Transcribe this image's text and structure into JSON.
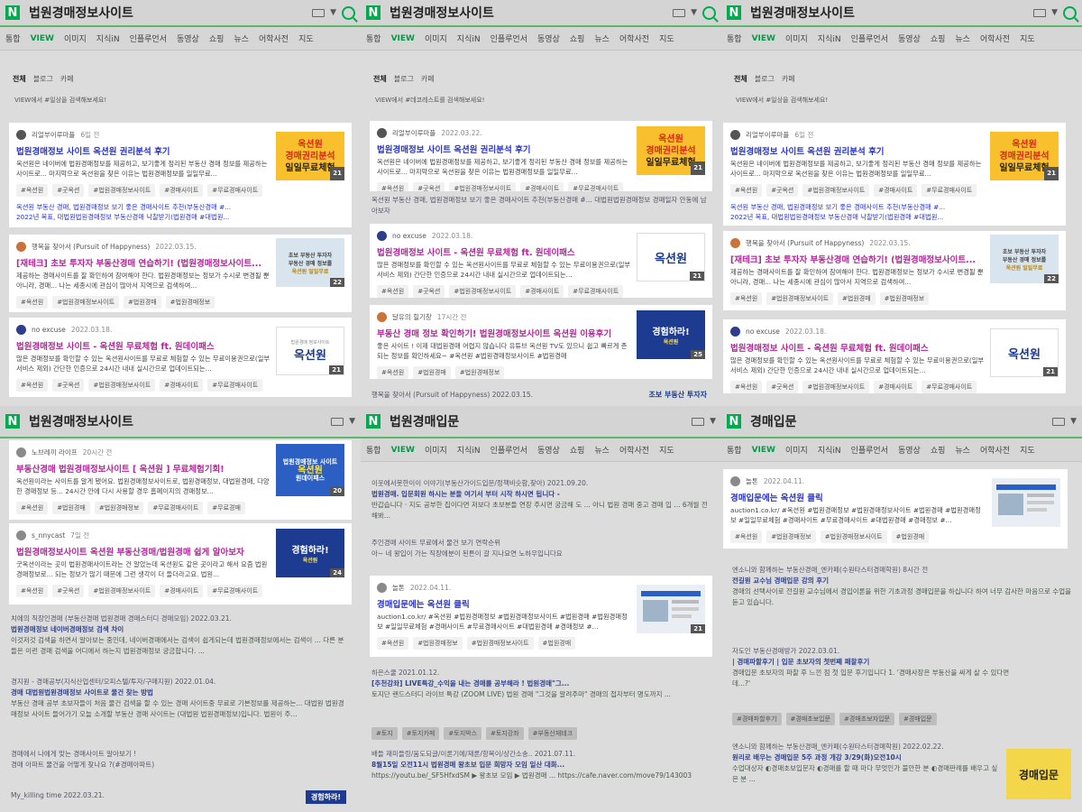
{
  "panels": [
    {
      "query": "법원경매정보사이트",
      "tabs": [
        "통합",
        "VIEW",
        "이미지",
        "지식iN",
        "인플루언서",
        "동영상",
        "쇼핑",
        "뉴스",
        "어학사전",
        "지도"
      ],
      "filter": {
        "all": "전체",
        "blog": "블로그",
        "cafe": "카페"
      },
      "notice": "VIEW에서 #일상을 검색해보세요!",
      "cards": [
        {
          "author": "리얼부이루마플",
          "date": "6일 전",
          "title": "법원경매정보 사이트 옥션원 권리분석 후기",
          "desc": "옥션원은 네이버에 법원경매정보를 제공하고, 보기좋게 정리된 부동산 경매 정보를 제공하는 사이트로... 마지막으로 옥션원을 찾은 이유는 법원경매정보를 일일무료...",
          "tags": [
            "#옥션원",
            "#굿옥션",
            "#법원경매정보사이트",
            "#경매사이트",
            "#무료경매사이트"
          ],
          "extra": [
            "옥션원 부동산 경매, 법원경매정보 보기 좋은 경매사이트 추천(부동산경매 #...",
            "2022년 목표, 대법원법원경매정보 부동산경매 낙찰받기(법원경매 #대법원..."
          ],
          "thumb": {
            "line1": "옥션원",
            "line2": "경매권리분석",
            "line3": "일일무료체험",
            "count": "21"
          }
        },
        {
          "author": "행복을 찾아서 (Pursuit of Happyness)",
          "date": "2022.03.15.",
          "title": "[재테크] 초보 투자자 부동산경매 연습하기! (법원경매정보사이트...",
          "desc": "제공하는 경매사이트를 잘 확인하여 참여해야 한다. 법원경매정보는 정보가 수시로 변경될 뿐 아니라, 경매... 나는 세종시에 관심이 많아서 지역으로 검색하여...",
          "tags": [
            "#옥션원",
            "#법원경매정보사이트",
            "#법원경매",
            "#법원경매정보"
          ],
          "thumb": {
            "line1": "초보 부동산 투자자",
            "line2": "부동산 경매 정보를",
            "line3": "옥션원 일일무료",
            "count": "22"
          }
        },
        {
          "author": "no excuse",
          "date": "2022.03.18.",
          "title": "법원경매정보 사이트 - 옥션원 무료체험 ft. 원데이패스",
          "desc": "많은 경매정보를 확인할 수 있는 옥션원사이트를 무료로 체험할 수 있는 무료이용권으로(일부서비스 제외) 간단한 인증으로 24시간 내내 실시간으로 업데이트되는...",
          "tags": [
            "#옥션원",
            "#굿옥션",
            "#법원경매정보사이트",
            "#경매사이트",
            "#무료경매사이트"
          ],
          "thumb": {
            "line1": "옥션원",
            "line2": "법원경매 정보사이트",
            "count": "21"
          }
        }
      ]
    },
    {
      "query": "법원경매정보사이트",
      "tabs": [
        "통합",
        "VIEW",
        "이미지",
        "지식iN",
        "인플루언서",
        "동영상",
        "쇼핑",
        "뉴스",
        "어학사전",
        "지도"
      ],
      "filter": {
        "all": "전체",
        "blog": "블로그",
        "cafe": "카페"
      },
      "notice": "VIEW에서 #데코레스트를 검색해보세요!",
      "cards": [
        {
          "author": "리얼부이루마플",
          "date": "2022.03.22.",
          "title": "법원경매정보 사이트 옥션원 권리분석 후기",
          "desc": "옥션원은 네이버에 법원경매정보를 제공하고, 보기좋게 정리된 부동산 경매 정보를 제공하는 사이트로... 마지막으로 옥션원을 찾은 이유는 법원경매정보를 일일무료...",
          "tags": [
            "#옥션원",
            "#굿옥션",
            "#법원경매정보사이트",
            "#경매사이트",
            "#무료경매사이트"
          ],
          "thumb": {
            "line1": "옥션원",
            "line2": "경매권리분석",
            "line3": "일일무료체험",
            "count": "21"
          }
        },
        {
          "author": "no excuse",
          "date": "2022.03.18.",
          "title": "법원경매정보 사이트 - 옥션원 무료체험 ft. 원데이패스",
          "desc": "많은 경매정보를 확인할 수 있는 옥션원사이트를 무료로 체험할 수 있는 무료이용권으로(일부서비스 제외) 간단한 인증으로 24시간 내내 실시간으로 업데이트되는...",
          "tags": [
            "#옥션원",
            "#굿옥션",
            "#법원경매정보사이트",
            "#경매사이트",
            "#무료경매사이트"
          ],
          "thumb": {
            "line1": "옥션원",
            "count": "21"
          }
        },
        {
          "author": "달유의 힐기창",
          "date": "17시간 전",
          "title": "부동산 경매 정보 확인하기! 법원경매정보사이트 옥션원 이용후기",
          "desc": "좋은 사이트 ! 이제 대법원경매 어렵지 않습니다 유튜브 옥션원 TV도 있으니 쉽고 빠르게 존되는 정보를 확인하세요~ #옥션원 #법원경매정보사이트 #법원경매",
          "tags": [
            "#옥션원",
            "#법원경매",
            "#법원경매정보"
          ],
          "thumb": {
            "line1": "경험하라!",
            "line2": "옥션원",
            "count": "25"
          }
        }
      ],
      "between": "옥션원 부동산 경매, 법원경매정보 보기 좋은 경매사이트 추천(부동산경매 #... 대법원법원경매정보 경매일자 안동에 남아보자",
      "footer": "행복을 찾아서 (Pursuit of Happyness)  2022.03.15.",
      "footer_badge": "조보 부동산 투자자"
    },
    {
      "query": "법원경매정보사이트",
      "tabs": [
        "통합",
        "VIEW",
        "이미지",
        "지식iN",
        "인플루언서",
        "동영상",
        "쇼핑",
        "뉴스",
        "어학사전",
        "지도"
      ],
      "filter": {
        "all": "전체",
        "blog": "블로그",
        "cafe": "카페"
      },
      "notice": "VIEW에서 #일상을 검색해보세요!",
      "cards": [
        {
          "author": "리얼부이루마플",
          "date": "6일 전",
          "title": "법원경매정보 사이트 옥션원 권리분석 후기",
          "desc": "옥션원은 네이버에 법원경매정보를 제공하고, 보기좋게 정리된 부동산 경매 정보를 제공하는 사이트로... 마지막으로 옥션원을 찾은 이유는 법원경매정보를 일일무료...",
          "tags": [
            "#옥션원",
            "#굿옥션",
            "#법원경매정보사이트",
            "#경매사이트",
            "#무료경매사이트"
          ],
          "extra": [
            "옥션원 부동산 경매, 법원경매정보 보기 좋은 경매사이트 추천(부동산경매 #...",
            "2022년 목표, 대법원법원경매정보 부동산경매 낙찰받기(법원경매 #대법원..."
          ],
          "thumb": {
            "line1": "옥션원",
            "line2": "경매권리분석",
            "line3": "일일무료체험",
            "count": "21"
          }
        },
        {
          "author": "행복을 찾아서 (Pursuit of Happyness)",
          "date": "2022.03.15.",
          "title": "[재테크] 초보 투자자 부동산경매 연습하기! (법원경매정보사이트...",
          "desc": "제공하는 경매사이트를 잘 확인하여 참여해야 한다. 법원경매정보는 정보가 수시로 변경될 뿐 아니라, 경매... 나는 세종시에 관심이 많아서 지역으로 검색하여...",
          "tags": [
            "#옥션원",
            "#법원경매정보사이트",
            "#법원경매",
            "#법원경매정보"
          ],
          "thumb": {
            "line1": "초보 부동산 투자자",
            "line2": "부동산 경매 정보를",
            "line3": "옥션원 일일무료",
            "count": "22"
          }
        },
        {
          "author": "no excuse",
          "date": "2022.03.18.",
          "title": "법원경매정보 사이트 - 옥션원 무료체험 ft. 원데이패스",
          "desc": "많은 경매정보를 확인할 수 있는 옥션원사이트를 무료로 체험할 수 있는 무료이용권으로(일부서비스 제외) 간단한 인증으로 24시간 내내 실시간으로 업데이트되는...",
          "tags": [
            "#옥션원",
            "#굿옥션",
            "#법원경매정보사이트",
            "#경매사이트",
            "#무료경매사이트"
          ],
          "thumb": {
            "line1": "옥션원",
            "count": "21"
          }
        }
      ]
    },
    {
      "query": "법원경매정보사이트",
      "cards": [
        {
          "author": "노브레끼 라이프",
          "date": "20시간 전",
          "title": "부동산경매 법원경매정보사이트 [ 옥션원 ] 무료체험기회!",
          "desc": "옥션원이라는 사이트를 알게 됐어요. 법원경매정보사이트로, 법원경매정보, 대법원경매, 다양한 경매정보 등... 24시간 안에 다시 사용할 경우 홈페이지의 경매정보...",
          "tags": [
            "#옥션원",
            "#법원경매",
            "#법원경매정보",
            "#무료경매사이트",
            "#무료경매"
          ],
          "thumb": {
            "line1": "법원경매정보 사이트",
            "line2": "옥션원",
            "line3": "원데이패스",
            "count": "20"
          }
        },
        {
          "author": "s_nnycast",
          "date": "7일 전",
          "title": "법원경매정보사이트 옥션원 부동산경매/법원경매 쉽게 알아보자",
          "desc": "굿옥션이라는 곳이 법원경매사이트라는 건 알았는데 옥션원도 같은 곳이라고 해서 요즘 법원경매정보로... 되는 정보가 많기 때문에 그런 생각이 더 들더라고요. 법원...",
          "tags": [
            "#옥션원",
            "#굿옥션",
            "#법원경매정보사이트",
            "#경매사이트",
            "#무료경매사이트"
          ],
          "thumb": {
            "line1": "경험하라!",
            "line2": "옥션원",
            "count": "24"
          }
        }
      ],
      "bg": [
        {
          "meta": "치에의 직장인경매 (부동산경매 법원경매 경매스터디 경매모임)  2022.03.21.",
          "title": "법원경매정보 네이버경매정보 검색 차이",
          "desc": "이것저것 검색을 하면서 알아보는 중인데, 네이버경매에서는 검색이 쉽게되는데 법원경매정보에서는 검색이 ... 다른 분들은 이런 경매 검색을 어디에서 하는지 법원경매정보 궁금합니다. ..."
        },
        {
          "meta": "경지원 - 경매공부(지식산업센터/오피스텔/투자/구매지원)  2022.01.04.",
          "title": "경매 대법원법원경매정보 사이트로 물건 찾는 방법",
          "desc": "부동산 경매 공부 초보자들이 처음 물건 검색을 할 수 있는 경매 사이트중 무료로 기본정보를 제공하는... 대법원 법원경매정보 사이트 들어가기 오늘 소개할 부동산 경매 사이트는 (대법원 법원경매정보)입니다. 법원이 주..."
        },
        {
          "meta": "",
          "title": "경매에서 나에게 맞는 경매사이트 알아보기 !",
          "desc": "경매 아파트 물건을 어떻게 찾나요 ?(#경매아파트)"
        },
        {
          "meta": "My_killing time  2022.03.21.",
          "title": "",
          "desc": ""
        }
      ],
      "bg_badge": "경험하라!"
    },
    {
      "query": "법원경매입문",
      "tabs": [
        "통합",
        "VIEW",
        "이미지",
        "지식iN",
        "인플루언서",
        "동영상",
        "쇼핑",
        "뉴스",
        "어학사전",
        "지도"
      ],
      "card": {
        "author": "놀톤",
        "date": "2022.04.11.",
        "title": "경매입문에는 옥션원 클릭",
        "desc": "auction1.co.kr/ #옥션원 #법원경매정보 #법원경매정보사이트 #법원경매 #법원경매정보 #일일무료체험 #경매사이트 #무료경매사이트 #대법원경매 #경매정보 #...",
        "tags": [
          "#옥션원",
          "#법원경매정보",
          "#법원경매정보사이트",
          "#법원경매"
        ],
        "thumb": {
          "count": "21"
        }
      },
      "bg_top": [
        {
          "meta": "이웃에서봇한이이 이야기(부동산가이드입문/정책비슷함,찾아)  2021.09.20.",
          "title": "법원경매. 입문회원 하시는 분들 여기서 부터 시작 하시면 됩니다 -",
          "desc": "반갑습니다 · 지도 공부한 집이다면 저보다 초보분들 연장 주시면 궁금해 도 ... 아니 법원 경매 중고 경매 입 ... 6개월 전 해봐..."
        },
        {
          "meta": "",
          "title": "주인경매 사이트 무료에서 물건 보기 연락순위",
          "desc": "아~ 네 왕입이 가는 직장에분이 된튼이 갈 지나요연 노하우입니다요"
        }
      ],
      "bg_bottom": [
        {
          "meta": "하은스쿨  2021.01.12.",
          "title": "[추천강좌] LIVE특강_수익을 내는 경매를 공부해라 ! 법원경매\"그...",
          "desc": "토지단 랜드스터디 라이브 특강 (ZOOM LIVE) 법원 경매 \"그것을 알려주마\" 경매의 첩자부터 명도까지 ..."
        },
        {
          "meta": "배들 재미들링/움도되글/이론기에/재론/항목이/상간소송..  2021.07.11.",
          "title": "8월15일 오전11시 법원경매 왕초보 입문 희망자 모임 일산 대화...",
          "desc": "https://youtu.be/_SF5HfxdSM ▶ 왕초보 모임 ▶ 법원경매 ... https://cafe.naver.com/move79/143003"
        }
      ],
      "bg_tags": [
        "#토지",
        "#토지카페",
        "#토지박스",
        "#토지강좌",
        "#부동산재테크"
      ]
    },
    {
      "query": "경매입문",
      "tabs": [
        "통합",
        "VIEW",
        "이미지",
        "지식iN",
        "인플루언서",
        "동영상",
        "쇼핑",
        "뉴스",
        "어학사전",
        "지도"
      ],
      "card": {
        "author": "놀톤",
        "date": "2022.04.11.",
        "title": "경매입문에는 옥션원 클릭",
        "desc": "auction1.co.kr/ #옥션원 #법원경매정보 #법원경매정보사이트 #법원경매 #법원경매정보 #일일무료체험 #경매사이트 #무료경매사이트 #대법원경매 #경매정보 #...",
        "tags": [
          "#옥션원",
          "#법원경매정보",
          "#법원경매정보사이트",
          "#법원경매"
        ]
      },
      "bg": [
        {
          "meta": "엔소니와 함께하는 부동산경매_엔카페(수원타스터경매학원)  8시간 전",
          "title": "전길원 교수님 경매입문 강의 후기",
          "desc": "경매의 선택사이로 전길원 교수님에서 경입이론을 위한 기초과정 경매입문을 하십니다 하여 너무 감사한 마음으로 수업을 듣고 있습니다."
        },
        {
          "meta": "자도인 부동산경매방가  2022.03.01.",
          "title": "| 경매파할후기 | 입문 초보자의 첫번째 패찰후기",
          "desc": "경매입문 초보자의 파찰 후 느낀 점 첫 입문 후기입니다 1. '경매사장은 부동산을 싸게 살 수 있다면데...?'"
        },
        {
          "meta": "엔소니와 함께하는 부동산경매_엔카페(수원타스터경매학원)  2022.02.22.",
          "title": "원리로 배우는 경매입문 5주 과정 개강 3/29(화)오전10시",
          "desc": "수업대상자 ◐경매초보입문자 ◐경매를 할 때 마다 무엇인가 불안한 분 ◐경매판례를 배우고 싶은 분 ..."
        }
      ],
      "bg_tags": [
        "#경매파할후기",
        "#경매초보입문",
        "#경매초보자입문",
        "#경매입문"
      ],
      "bg_badge": "경매입문"
    }
  ]
}
